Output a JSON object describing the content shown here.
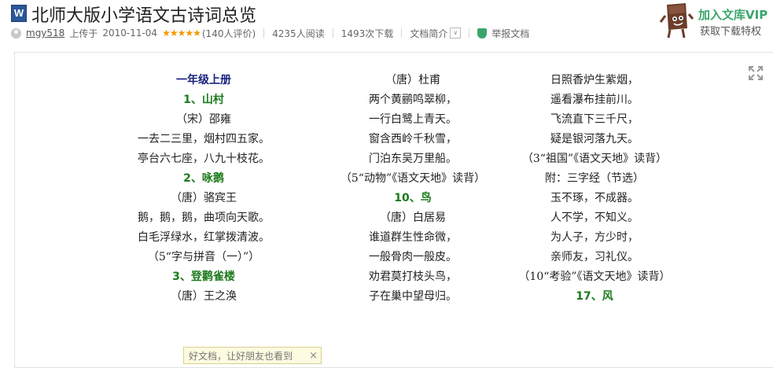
{
  "header": {
    "doc_icon_letter": "W",
    "title": "北师大版小学语文古诗词总览",
    "meta": {
      "username": "mgy518",
      "uploaded_label": "上传于",
      "upload_date": "2010-11-04",
      "stars": "★★★★★",
      "rating_count": "(140人评价)",
      "reads": "4235人阅读",
      "downloads": "1493次下载",
      "doc_intro": "文档简介",
      "dropdown_glyph": "∨",
      "report": "举报文档"
    },
    "vip": {
      "title": "加入文库VIP",
      "subtitle": "获取下载特权"
    }
  },
  "document": {
    "columns": [
      [
        {
          "text": "一年级上册",
          "style": "grade"
        },
        {
          "text": "1、山村",
          "style": "title"
        },
        {
          "text": "（宋）邵雍",
          "style": "body"
        },
        {
          "text": "一去二三里，烟村四五家。",
          "style": "body"
        },
        {
          "text": "亭台六七座，八九十枝花。",
          "style": "body"
        },
        {
          "text": "2、咏鹅",
          "style": "title"
        },
        {
          "text": "（唐）骆宾王",
          "style": "body"
        },
        {
          "text": "鹅，鹅，鹅，曲项向天歌。",
          "style": "body"
        },
        {
          "text": "白毛浮绿水，红掌拨清波。",
          "style": "body"
        },
        {
          "text": "（5“字与拼音（一）”）",
          "style": "body"
        },
        {
          "text": "3、登鹳雀楼",
          "style": "title"
        },
        {
          "text": "（唐）王之涣",
          "style": "body"
        }
      ],
      [
        {
          "text": "（唐）杜甫",
          "style": "body"
        },
        {
          "text": "两个黄鹂鸣翠柳，",
          "style": "body"
        },
        {
          "text": "一行白鹭上青天。",
          "style": "body"
        },
        {
          "text": "窗含西岭千秋雪，",
          "style": "body"
        },
        {
          "text": "门泊东吴万里船。",
          "style": "body"
        },
        {
          "text": "（5“动物”《语文天地》读背）",
          "style": "body"
        },
        {
          "text": "10、鸟",
          "style": "title"
        },
        {
          "text": "（唐）白居易",
          "style": "body"
        },
        {
          "text": "谁道群生性命微，",
          "style": "body"
        },
        {
          "text": "一般骨肉一般皮。",
          "style": "body"
        },
        {
          "text": "劝君莫打枝头鸟，",
          "style": "body"
        },
        {
          "text": "子在巢中望母归。",
          "style": "body"
        }
      ],
      [
        {
          "text": "日照香炉生紫烟，",
          "style": "body"
        },
        {
          "text": "遥看瀑布挂前川。",
          "style": "body"
        },
        {
          "text": "飞流直下三千尺，",
          "style": "body"
        },
        {
          "text": "疑是银河落九天。",
          "style": "body"
        },
        {
          "text": "（3“祖国”《语文天地》读背）",
          "style": "body"
        },
        {
          "text": "附：三字经（节选）",
          "style": "body"
        },
        {
          "text": "玉不琢，不成器。",
          "style": "body"
        },
        {
          "text": "人不学，不知义。",
          "style": "body"
        },
        {
          "text": "为人子，方少时，",
          "style": "body"
        },
        {
          "text": "亲师友，习礼仪。",
          "style": "body"
        },
        {
          "text": "（10“考验”《语文天地》读背）",
          "style": "body"
        },
        {
          "text": "17、风",
          "style": "title"
        }
      ]
    ]
  },
  "tooltip": {
    "text": "好文档，让好朋友也看到",
    "close": "×"
  }
}
